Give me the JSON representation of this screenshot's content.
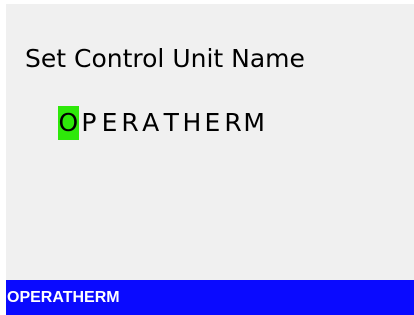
{
  "screen": {
    "title": "Set Control Unit Name",
    "name_value": "OPERATHERM",
    "cursor_index": 0,
    "cursor_color": "#2ee80a"
  },
  "status_bar": {
    "text": "OPERATHERM",
    "background": "#0a0aff"
  }
}
